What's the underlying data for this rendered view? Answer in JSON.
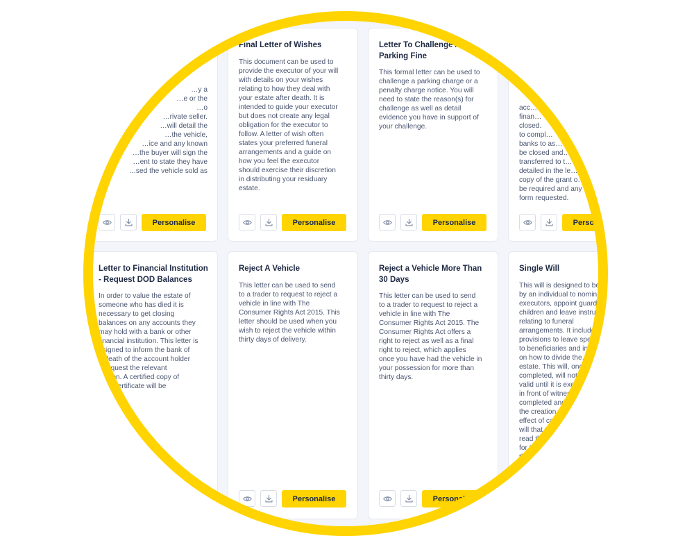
{
  "button_label": "Personalise",
  "icons": {
    "view": "eye-icon",
    "download": "download-icon"
  },
  "colors": {
    "accent": "#ffd400",
    "text": "#1f2a44",
    "muted": "#4a5570",
    "icon": "#7f8aa3"
  },
  "cards": [
    {
      "title": "",
      "description": "…y a\n…e or the\n…o\n…rivate seller.\n…will detail the\n…the vehicle,\n…ice and any known\n…the buyer will sign the\n…ent to state they have\n…sed the vehicle sold as"
    },
    {
      "title": "Final Letter of Wishes",
      "description": "This document can be used to\nprovide the executor of your will\nwith details on your wishes\nrelating to how they deal with\nyour estate after death. It is\nintended to guide your executor\nbut does not create any legal\nobligation for the executor to\nfollow. A letter of wish often\nstates your preferred funeral\narrangements and a guide on\nhow you feel the executor\nshould exercise their discretion\nin distributing your residuary\nestate."
    },
    {
      "title": "Letter To Challenge A\nParking Fine",
      "description": "This formal letter can be used to\nchallenge a parking charge or a\npenalty charge notice. You will\nneed to state the reason(s) for\nchallenge as well as detail\nevidence you have in support of\nyour challenge."
    },
    {
      "title": "",
      "description": "acc…\nfinan…\nclosed.\nto compl…\nbanks to as…\nbe closed and…\ntransferred to t…\ndetailed in the le…\ncopy of the grant o…\nbe required and any\nform requested."
    },
    {
      "title": "Letter to Financial Institution\n- Request DOD Balances",
      "description": "In order to value the estate of\nsomeone who has died it is\nnecessary to get closing\nbalances on any accounts they\nmay hold with a bank or other\nfinancial institution. This letter is\nesigned to inform the bank of\ne death of the account holder\nd request the relevant\nmation. A certified copy of\neath certificate will be\nd."
    },
    {
      "title": "Reject A Vehicle",
      "description": "This letter can be used to send\nto a trader to request to reject a\nvehicle in line with The\nConsumer Rights Act 2015. This\nletter should be used when you\nwish to reject the vehicle within\nthirty days of delivery."
    },
    {
      "title": "Reject a Vehicle More Than\n30 Days",
      "description": "This letter can be used to send\nto a trader to request to reject a\nvehicle in line with The\nConsumer Rights Act 2015. The\nConsumer Rights Act offers a\nright to reject as well as a final\nright to reject, which applies\nonce you have had the vehicle in\nyour possession for more than\nthirty days."
    },
    {
      "title": "Single Will",
      "description": "This will is designed to be\nby an individual to nomin…\nexecutors, appoint guard…\nchildren and leave instru…\nrelating to funeral\narrangements. It include…\nprovisions to leave spe…\nto beneficiaries and in…\non how to divide the…\nestate. This will, once…\ncompleted, will not…\nvalid until it is exe…\nin front of witnes…\ncompleted and…\nthe creation o…\neffect of ca…\nwill that y…\nread th…\nfor th…\nthe b…\nf…"
    }
  ]
}
